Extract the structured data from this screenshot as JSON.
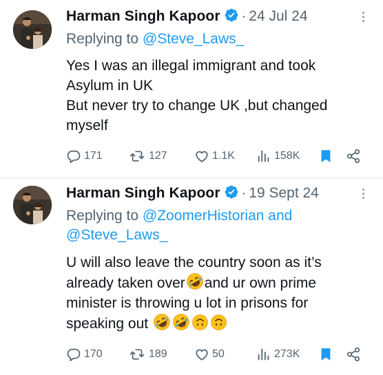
{
  "tweets": [
    {
      "author": "Harman Singh Kapoor",
      "separator": "·",
      "date": "24 Jul 24",
      "reply_prefix": "Replying to",
      "reply_to_line1": "@Steve_Laws_",
      "reply_to_line2": "",
      "lines": [
        "Yes I was an illegal immigrant and took",
        "Asylum in UK",
        "But never try to change UK ,but changed",
        "myself"
      ],
      "replies": "171",
      "retweets": "127",
      "likes": "1.1K",
      "views": "158K"
    },
    {
      "author": "Harman Singh Kapoor",
      "separator": "·",
      "date": "19 Sept 24",
      "reply_prefix": "Replying to",
      "reply_to_line1": "@ZoomerHistorian and",
      "reply_to_line2": "@Steve_Laws_",
      "lines": [
        "U will also leave the country soon as it’s",
        "already taken over",
        "and ur own prime",
        "minister is throwing u lot in prisons for",
        "speaking out"
      ],
      "replies": "170",
      "retweets": "189",
      "likes": "50",
      "views": "273K"
    }
  ],
  "icons": {
    "verified": "verified-badge-icon",
    "more": "more-dots-icon",
    "reply": "reply-icon",
    "retweet": "retweet-icon",
    "like": "heart-icon",
    "views": "views-chart-icon",
    "bookmark": "bookmark-icon",
    "share": "share-icon",
    "emoji_rofl": "rolling-laughing-emoji",
    "emoji_upside_down": "upside-down-face-emoji"
  },
  "colors": {
    "accent": "#1d9bf0",
    "text": "#0f1419",
    "secondary": "#536471"
  }
}
